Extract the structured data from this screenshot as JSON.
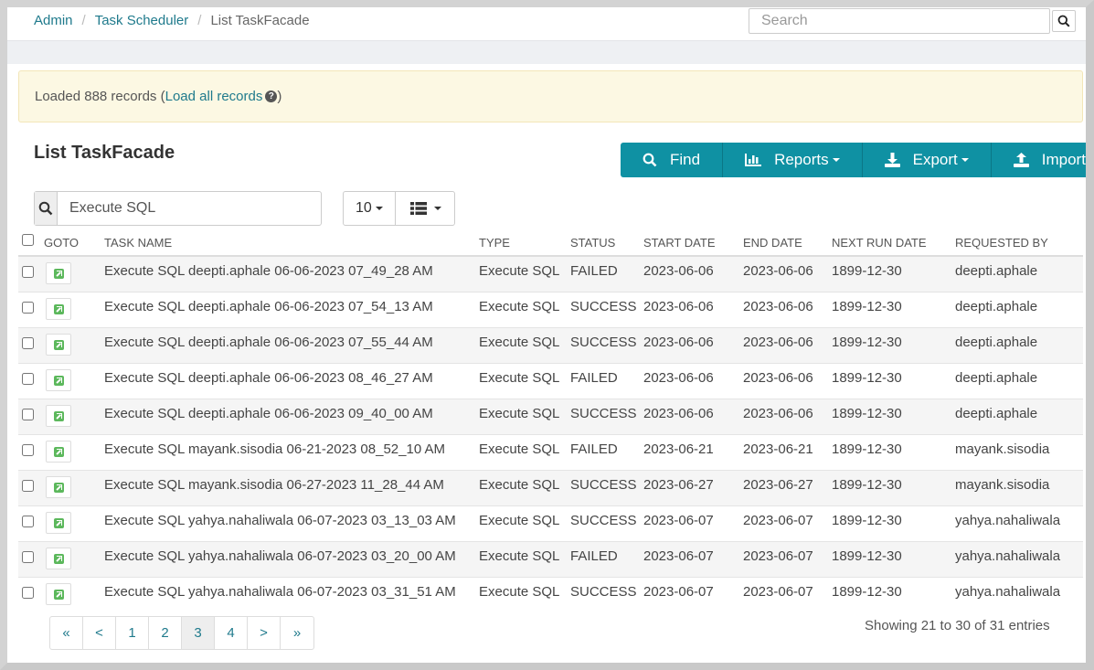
{
  "breadcrumb": {
    "admin": "Admin",
    "scheduler": "Task Scheduler",
    "current": "List TaskFacade"
  },
  "search": {
    "placeholder": "Search"
  },
  "alert": {
    "prefix": "Loaded 888 records (",
    "link": "Load all records",
    "suffix": ")"
  },
  "list": {
    "title": "List TaskFacade"
  },
  "toolbar": {
    "find": "Find",
    "reports": "Reports",
    "export": "Export",
    "import": "Import"
  },
  "filter": {
    "value": "Execute SQL"
  },
  "page_size": {
    "selected": "10"
  },
  "columns": {
    "goto": "GOTO",
    "task_name": "TASK NAME",
    "type": "TYPE",
    "status": "STATUS",
    "start_date": "START DATE",
    "end_date": "END DATE",
    "next_run_date": "NEXT RUN DATE",
    "requested_by": "REQUESTED BY"
  },
  "rows": [
    {
      "task_name": "Execute SQL deepti.aphale 06-06-2023 07_49_28 AM",
      "type": "Execute SQL",
      "status": "FAILED",
      "start_date": "2023-06-06",
      "end_date": "2023-06-06",
      "next_run_date": "1899-12-30",
      "requested_by": "deepti.aphale"
    },
    {
      "task_name": "Execute SQL deepti.aphale 06-06-2023 07_54_13 AM",
      "type": "Execute SQL",
      "status": "SUCCESS",
      "start_date": "2023-06-06",
      "end_date": "2023-06-06",
      "next_run_date": "1899-12-30",
      "requested_by": "deepti.aphale"
    },
    {
      "task_name": "Execute SQL deepti.aphale 06-06-2023 07_55_44 AM",
      "type": "Execute SQL",
      "status": "SUCCESS",
      "start_date": "2023-06-06",
      "end_date": "2023-06-06",
      "next_run_date": "1899-12-30",
      "requested_by": "deepti.aphale"
    },
    {
      "task_name": "Execute SQL deepti.aphale 06-06-2023 08_46_27 AM",
      "type": "Execute SQL",
      "status": "FAILED",
      "start_date": "2023-06-06",
      "end_date": "2023-06-06",
      "next_run_date": "1899-12-30",
      "requested_by": "deepti.aphale"
    },
    {
      "task_name": "Execute SQL deepti.aphale 06-06-2023 09_40_00 AM",
      "type": "Execute SQL",
      "status": "SUCCESS",
      "start_date": "2023-06-06",
      "end_date": "2023-06-06",
      "next_run_date": "1899-12-30",
      "requested_by": "deepti.aphale"
    },
    {
      "task_name": "Execute SQL mayank.sisodia 06-21-2023 08_52_10 AM",
      "type": "Execute SQL",
      "status": "FAILED",
      "start_date": "2023-06-21",
      "end_date": "2023-06-21",
      "next_run_date": "1899-12-30",
      "requested_by": "mayank.sisodia"
    },
    {
      "task_name": "Execute SQL mayank.sisodia 06-27-2023 11_28_44 AM",
      "type": "Execute SQL",
      "status": "SUCCESS",
      "start_date": "2023-06-27",
      "end_date": "2023-06-27",
      "next_run_date": "1899-12-30",
      "requested_by": "mayank.sisodia"
    },
    {
      "task_name": "Execute SQL yahya.nahaliwala 06-07-2023 03_13_03 AM",
      "type": "Execute SQL",
      "status": "SUCCESS",
      "start_date": "2023-06-07",
      "end_date": "2023-06-07",
      "next_run_date": "1899-12-30",
      "requested_by": "yahya.nahaliwala"
    },
    {
      "task_name": "Execute SQL yahya.nahaliwala 06-07-2023 03_20_00 AM",
      "type": "Execute SQL",
      "status": "FAILED",
      "start_date": "2023-06-07",
      "end_date": "2023-06-07",
      "next_run_date": "1899-12-30",
      "requested_by": "yahya.nahaliwala"
    },
    {
      "task_name": "Execute SQL yahya.nahaliwala 06-07-2023 03_31_51 AM",
      "type": "Execute SQL",
      "status": "SUCCESS",
      "start_date": "2023-06-07",
      "end_date": "2023-06-07",
      "next_run_date": "1899-12-30",
      "requested_by": "yahya.nahaliwala"
    }
  ],
  "pagination": {
    "first": "«",
    "prev": "<",
    "pages": [
      "1",
      "2",
      "3",
      "4"
    ],
    "active_page": "3",
    "next": ">",
    "last": "»"
  },
  "entries_info": "Showing 21 to 30 of 31 entries",
  "colors": {
    "accent": "#0f91a3",
    "link": "#1f7a8c",
    "alert_bg": "#fcf8e3",
    "goto_icon": "#5cb85c"
  }
}
